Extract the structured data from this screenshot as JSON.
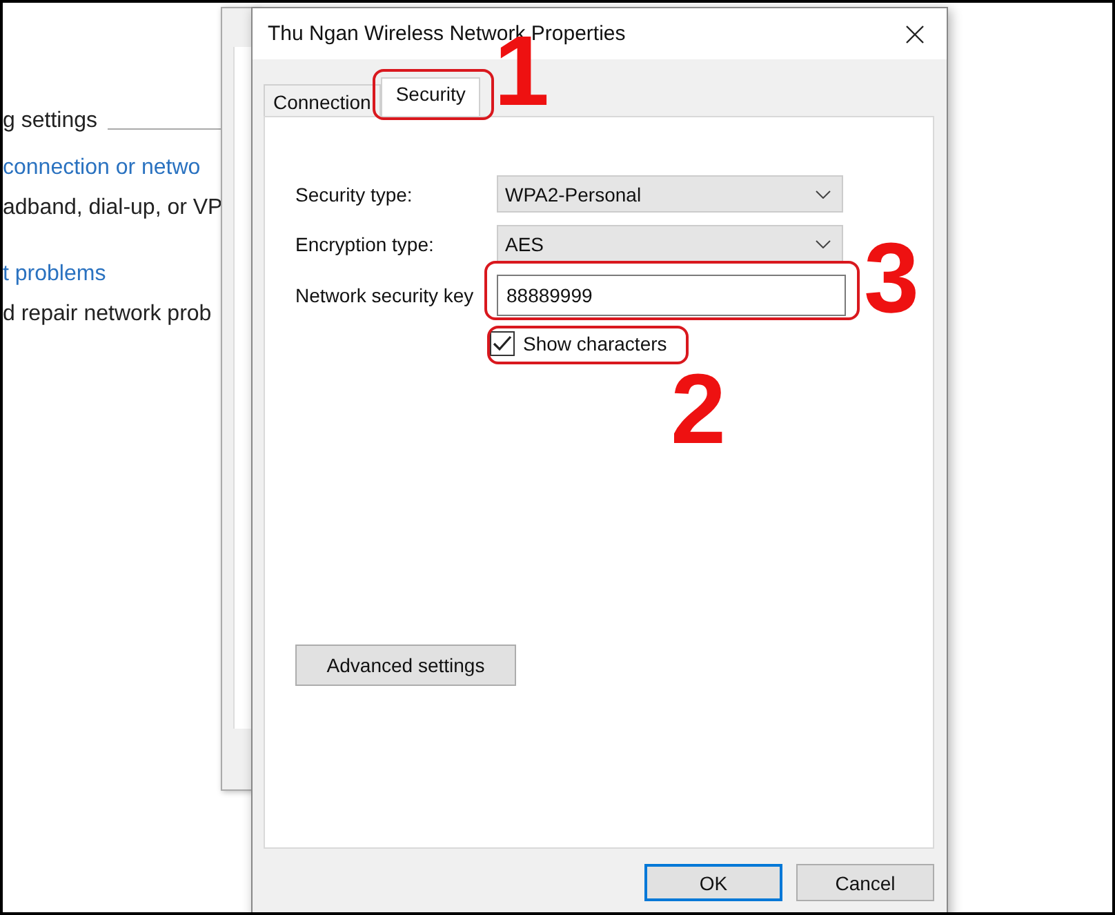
{
  "background_window": {
    "items": [
      {
        "kind": "heading",
        "text": "g settings"
      },
      {
        "kind": "link",
        "text": "connection or netwo"
      },
      {
        "kind": "text",
        "text": "adband, dial-up, or VP"
      },
      {
        "kind": "link",
        "text": "t problems"
      },
      {
        "kind": "text",
        "text": "d repair network prob"
      }
    ]
  },
  "dialog": {
    "title": "Thu Ngan Wireless Network Properties",
    "tabs": [
      {
        "label": "Connection",
        "selected": false
      },
      {
        "label": "Security",
        "selected": true
      }
    ],
    "fields": [
      {
        "kind": "dropdown",
        "label": "Security type:",
        "value": "WPA2-Personal"
      },
      {
        "kind": "dropdown",
        "label": "Encryption type:",
        "value": "AES"
      },
      {
        "kind": "text",
        "label": "Network security key",
        "value": "88889999"
      }
    ],
    "show_characters": {
      "label": "Show characters",
      "checked": true
    },
    "advanced_button": "Advanced settings",
    "buttons": [
      {
        "label": "OK",
        "default": true
      },
      {
        "label": "Cancel",
        "default": false
      }
    ]
  },
  "annotations": [
    {
      "kind": "tab",
      "number": "1"
    },
    {
      "kind": "checkbox",
      "number": "2"
    },
    {
      "kind": "key",
      "number": "3"
    }
  ]
}
